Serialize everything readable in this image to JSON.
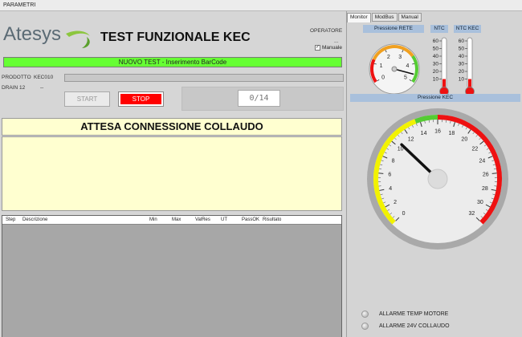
{
  "menubar": {
    "label": "PARAMETRI"
  },
  "header": {
    "logo_text": "Atesys",
    "title": "TEST FUNZIONALE KEC",
    "operator_label": "OPERATORE",
    "operator_value": "...",
    "manual_label": "Manuale",
    "manual_checked": true
  },
  "status_bar": {
    "text": "NUOVO TEST - Inserimento BarCode",
    "color": "#66ff33"
  },
  "product": {
    "label": "PRODOTTO",
    "value": "KEC010"
  },
  "drain": {
    "label": "DRAIN 12",
    "value": "--"
  },
  "buttons": {
    "start": "START",
    "stop": "STOP"
  },
  "counter": {
    "text": "0/14"
  },
  "message": {
    "title": "ATTESA CONNESSIONE COLLAUDO",
    "body": ""
  },
  "table": {
    "columns": [
      "Step",
      "Descrizione",
      "Min",
      "Max",
      "ValRes",
      "UT",
      "PassOK",
      "Risultato"
    ],
    "rows": []
  },
  "right_panel": {
    "tabs": [
      {
        "label": "Monitor",
        "active": true
      },
      {
        "label": "ModBus",
        "active": false
      },
      {
        "label": "Manual",
        "active": false
      }
    ],
    "pressione_rete": {
      "label": "Pressione RETE",
      "ticks": [
        "0",
        "1",
        "2",
        "3",
        "4",
        "5"
      ],
      "value": 4.6,
      "max": 5
    },
    "ntc": {
      "label": "NTC",
      "ticks": [
        "60",
        "50",
        "40",
        "30",
        "20",
        "10"
      ],
      "value": 10
    },
    "ntc_kec": {
      "label": "NTC KEC",
      "ticks": [
        "60",
        "50",
        "40",
        "30",
        "20",
        "10"
      ],
      "value": 10
    },
    "pressione_kec": {
      "label": "Pressione KEC",
      "ticks": [
        "0",
        "2",
        "4",
        "6",
        "8",
        "10",
        "12",
        "14",
        "16",
        "18",
        "20",
        "22",
        "24",
        "26",
        "28",
        "30",
        "32"
      ],
      "value": 10.5,
      "max": 32
    },
    "alarms": [
      {
        "label": "ALLARME TEMP MOTORE"
      },
      {
        "label": "ALLARME 24V COLLAUDO"
      }
    ]
  },
  "colors": {
    "accent_red": "#ee1111",
    "gauge_yellow": "#f2f200",
    "gauge_green": "#55cc33",
    "panel_header": "#a9c0dc",
    "message_bg": "#ffffd0"
  }
}
